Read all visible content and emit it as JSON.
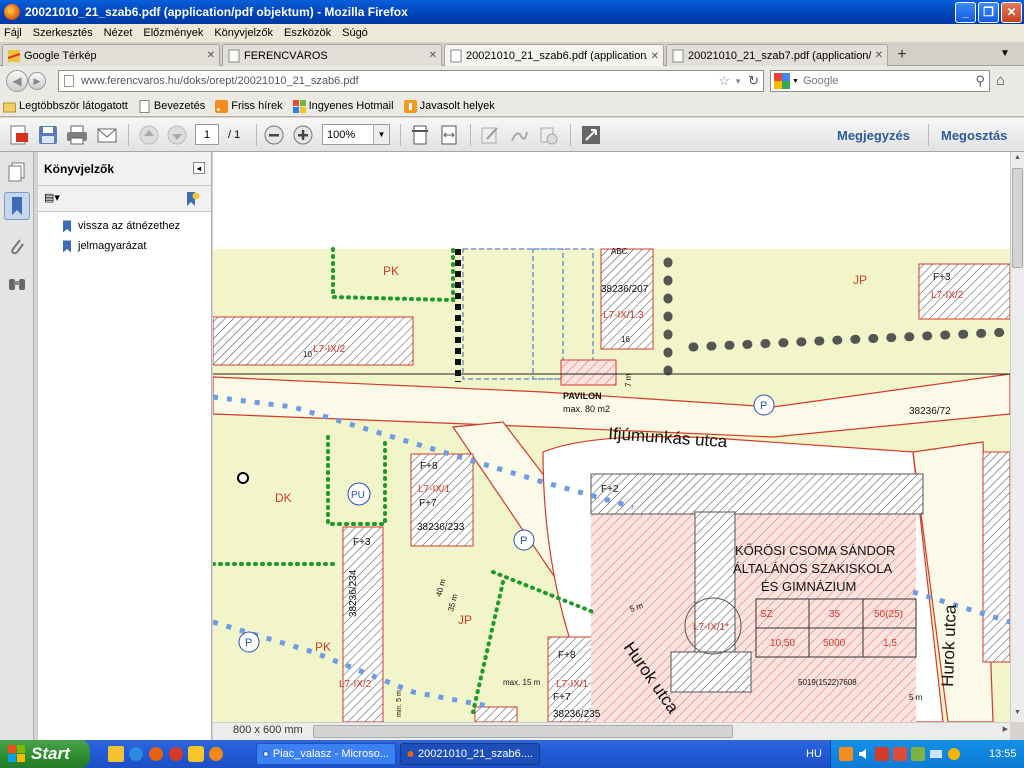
{
  "window": {
    "title": "20021010_21_szab6.pdf (application/pdf objektum) - Mozilla Firefox",
    "min_label": "_",
    "max_label": "❐",
    "close_label": "✕"
  },
  "menu": [
    "Fájl",
    "Szerkesztés",
    "Nézet",
    "Előzmények",
    "Könyvjelzők",
    "Eszközök",
    "Súgó"
  ],
  "tabs": [
    {
      "label": "Google Térkép",
      "active": false
    },
    {
      "label": "FERENCVÁROS",
      "active": false
    },
    {
      "label": "20021010_21_szab6.pdf (application/pd...",
      "active": true
    },
    {
      "label": "20021010_21_szab7.pdf (application/pd...",
      "active": false
    }
  ],
  "newtab_label": "+",
  "nav": {
    "url": "www.ferencvaros.hu/doks/orept/20021010_21_szab6.pdf",
    "search_placeholder": "Google",
    "back_icon": "◀",
    "fwd_icon": "▶"
  },
  "bookmarks_bar": [
    "Legtöbbször látogatott",
    "Bevezetés",
    "Friss hírek",
    "Ingyenes Hotmail",
    "Javasolt helyek"
  ],
  "pdf_toolbar": {
    "page_current": "1",
    "page_total": "/ 1",
    "zoom": "100%",
    "comment_label": "Megjegyzés",
    "share_label": "Megosztás"
  },
  "bookmarks_panel": {
    "title": "Könyvjelzők",
    "items": [
      "vissza az átnézethez",
      "jelmagyarázat"
    ]
  },
  "page_size": "800 x 600 mm",
  "map": {
    "labels": {
      "pk1": "PK",
      "jp1": "JP",
      "dk": "DK",
      "pu": "PU",
      "jp2": "JP",
      "pk2": "PK",
      "l7_2a": "L7-IX/2",
      "l7_13": "L7-IX/1.3",
      "l7_2b": "L7-IX/2",
      "l7_1a": "L7-IX/1",
      "l7_2c": "L7-IX/2",
      "l7_1b": "L7-IX/1",
      "l7_1c": "L7-IX/1*",
      "f3a": "F+3",
      "f8a": "F+8",
      "f7a": "F+7",
      "f2": "F+2",
      "f3b": "F+3",
      "f8b": "F+8",
      "f7b": "F+7",
      "n38236_207": "38236/207",
      "n38236_72": "38236/72",
      "n38236_233": "38236/233",
      "n38236_234": "38236/234",
      "n38236_235": "38236/235",
      "n5019": "5019(1522)7608",
      "n10": "10",
      "n16": "16",
      "pavilon": "PAVILON",
      "pavilon_max": "max. 80 m2",
      "street1": "Ifjúmunkás utca",
      "street2": "Hurok utca",
      "street3": "Hurok utca",
      "school1": "KŐRÖSI CSOMA SÁNDOR",
      "school2": "ÁLTALÁNOS SZAKISKOLA",
      "school3": "ÉS GIMNÁZIUM",
      "d7m": "7 m",
      "d40m": "40 m",
      "d35m": "35 m",
      "d5m": "5 m",
      "d5m2": "5 m",
      "dmax15": "max. 15 m",
      "dmin5": "min. 5 m",
      "p": "P",
      "abc": "ABC"
    },
    "school_table": [
      [
        "SZ",
        "35",
        "50(25)"
      ],
      [
        "10,50",
        "5000",
        "1,5"
      ]
    ]
  },
  "taskbar": {
    "start": "Start",
    "tasks": [
      "Piac_valasz - Microso...",
      "20021010_21_szab6...."
    ],
    "lang": "HU",
    "clock": "13:55"
  }
}
